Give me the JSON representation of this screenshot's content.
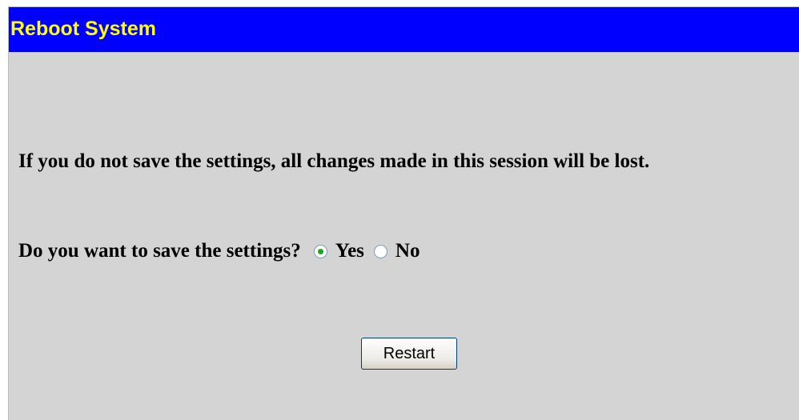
{
  "header": {
    "title": "Reboot System"
  },
  "content": {
    "warning_text": "If you do not save the settings, all changes made in this session will be lost.",
    "question_text": "Do you want to save the settings?",
    "options": [
      {
        "label": "Yes",
        "selected": true
      },
      {
        "label": "No",
        "selected": false
      }
    ],
    "restart_label": "Restart"
  },
  "colors": {
    "title_bar": "#0000ff",
    "title_text": "#ffff00",
    "panel_background": "#d4d4d4"
  }
}
